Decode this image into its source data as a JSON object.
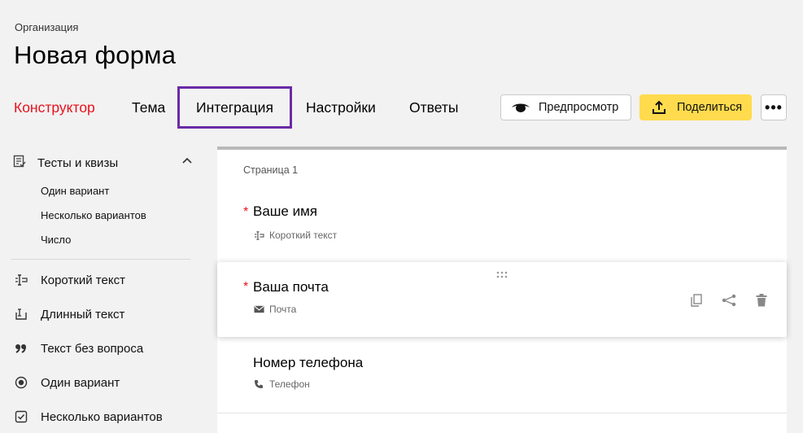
{
  "header": {
    "org": "Организация",
    "title": "Новая форма"
  },
  "tabs": [
    {
      "label": "Конструктор"
    },
    {
      "label": "Тема"
    },
    {
      "label": "Интеграция"
    },
    {
      "label": "Настройки"
    },
    {
      "label": "Ответы"
    }
  ],
  "toolbar": {
    "preview_label": "Предпросмотр",
    "share_label": "Поделиться",
    "more_label": "•••"
  },
  "sidebar": {
    "group_label": "Тесты и квизы",
    "sub_items": [
      "Один вариант",
      "Несколько вариантов",
      "Число"
    ],
    "items": [
      "Короткий текст",
      "Длинный текст",
      "Текст без вопроса",
      "Один вариант",
      "Несколько вариантов"
    ]
  },
  "form": {
    "page_label": "Страница 1",
    "questions": [
      {
        "title": "Ваше имя",
        "type": "Короткий текст",
        "required_mark": "*"
      },
      {
        "title": "Ваша почта",
        "type": "Почта",
        "required_mark": "*"
      },
      {
        "title": "Номер телефона",
        "type": "Телефон"
      }
    ]
  },
  "colors": {
    "accent": "#e8111d",
    "share_button": "#ffdb4d",
    "highlight_frame": "#6b2aa6"
  }
}
